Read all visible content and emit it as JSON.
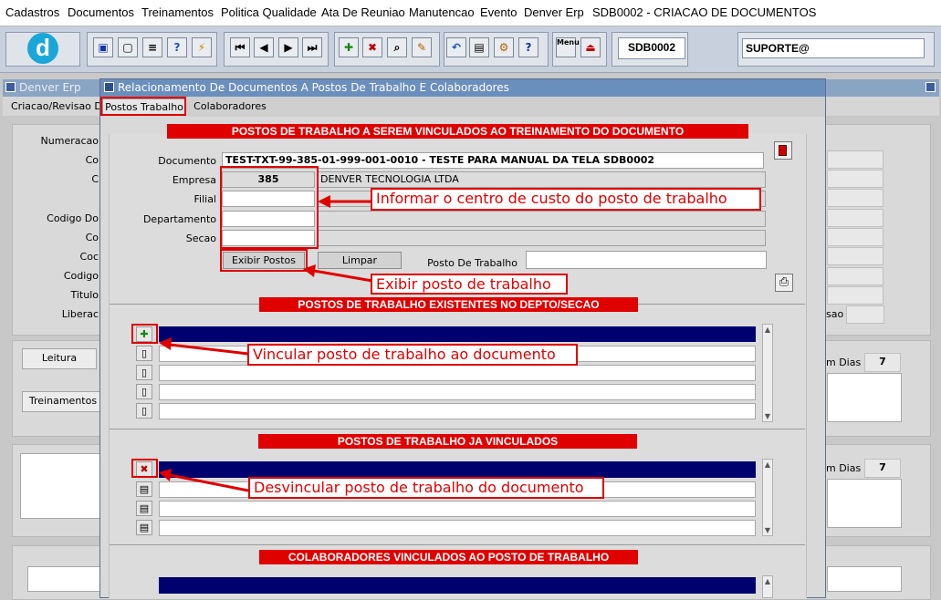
{
  "menu": [
    "Cadastros",
    "Documentos",
    "Treinamentos",
    "Politica Qualidade",
    "Ata De Reuniao",
    "Manutencao",
    "Evento",
    "Denver Erp",
    "SDB0002 - CRIACAO DE DOCUMENTOS"
  ],
  "toolbar": {
    "logo": "d",
    "screen_code": "SDB0002",
    "user": "SUPORTE@",
    "btn_menu_label": "Menu"
  },
  "background_window": {
    "title": "Denver Erp",
    "tab": "Criacao/Revisao Do",
    "labels": [
      "Numeracao",
      "Co",
      "C",
      "Codigo Do",
      "Co",
      "Coc",
      "Codigo",
      "Titulo",
      "Liberac"
    ],
    "sao_label": "sao",
    "btn_leitura": "Leitura",
    "btn_treinamentos": "Treinamentos",
    "dias_label": "m Dias",
    "dias_value_1": "7",
    "dias_value_2": "7"
  },
  "modal": {
    "title": "Relacionamento De Documentos A Postos De Trabalho E Colaboradores",
    "tabs": [
      "Postos Trabalho",
      "Colaboradores"
    ],
    "section1": "POSTOS DE TRABALHO A SEREM VINCULADOS AO TREINAMENTO DO DOCUMENTO",
    "documento_label": "Documento",
    "documento_value": "TEST-TXT-99-385-01-999-001-0010 - TESTE PARA MANUAL DA TELA SDB0002",
    "empresa_label": "Empresa",
    "empresa_code": "385",
    "empresa_name": "DENVER TECNOLOGIA LTDA",
    "filial_label": "Filial",
    "departamento_label": "Departamento",
    "secao_label": "Secao",
    "btn_exibir": "Exibir Postos",
    "btn_limpar": "Limpar",
    "posto_label": "Posto De Trabalho",
    "section2": "POSTOS DE TRABALHO EXISTENTES NO DEPTO/SECAO",
    "section3": "POSTOS DE TRABALHO JA VINCULADOS",
    "section4": "COLABORADORES VINCULADOS AO POSTO DE TRABALHO"
  },
  "annotations": {
    "filial_note": "Informar o centro de custo do posto de trabalho",
    "exibir_note": "Exibir posto de trabalho",
    "vincular_note": "Vincular posto de trabalho ao documento",
    "desvincular_note": "Desvincular posto de trabalho do documento"
  },
  "colors": {
    "accent_red": "#e00000",
    "selected_row": "#00006e",
    "title_blue": "#6b8fbd"
  }
}
